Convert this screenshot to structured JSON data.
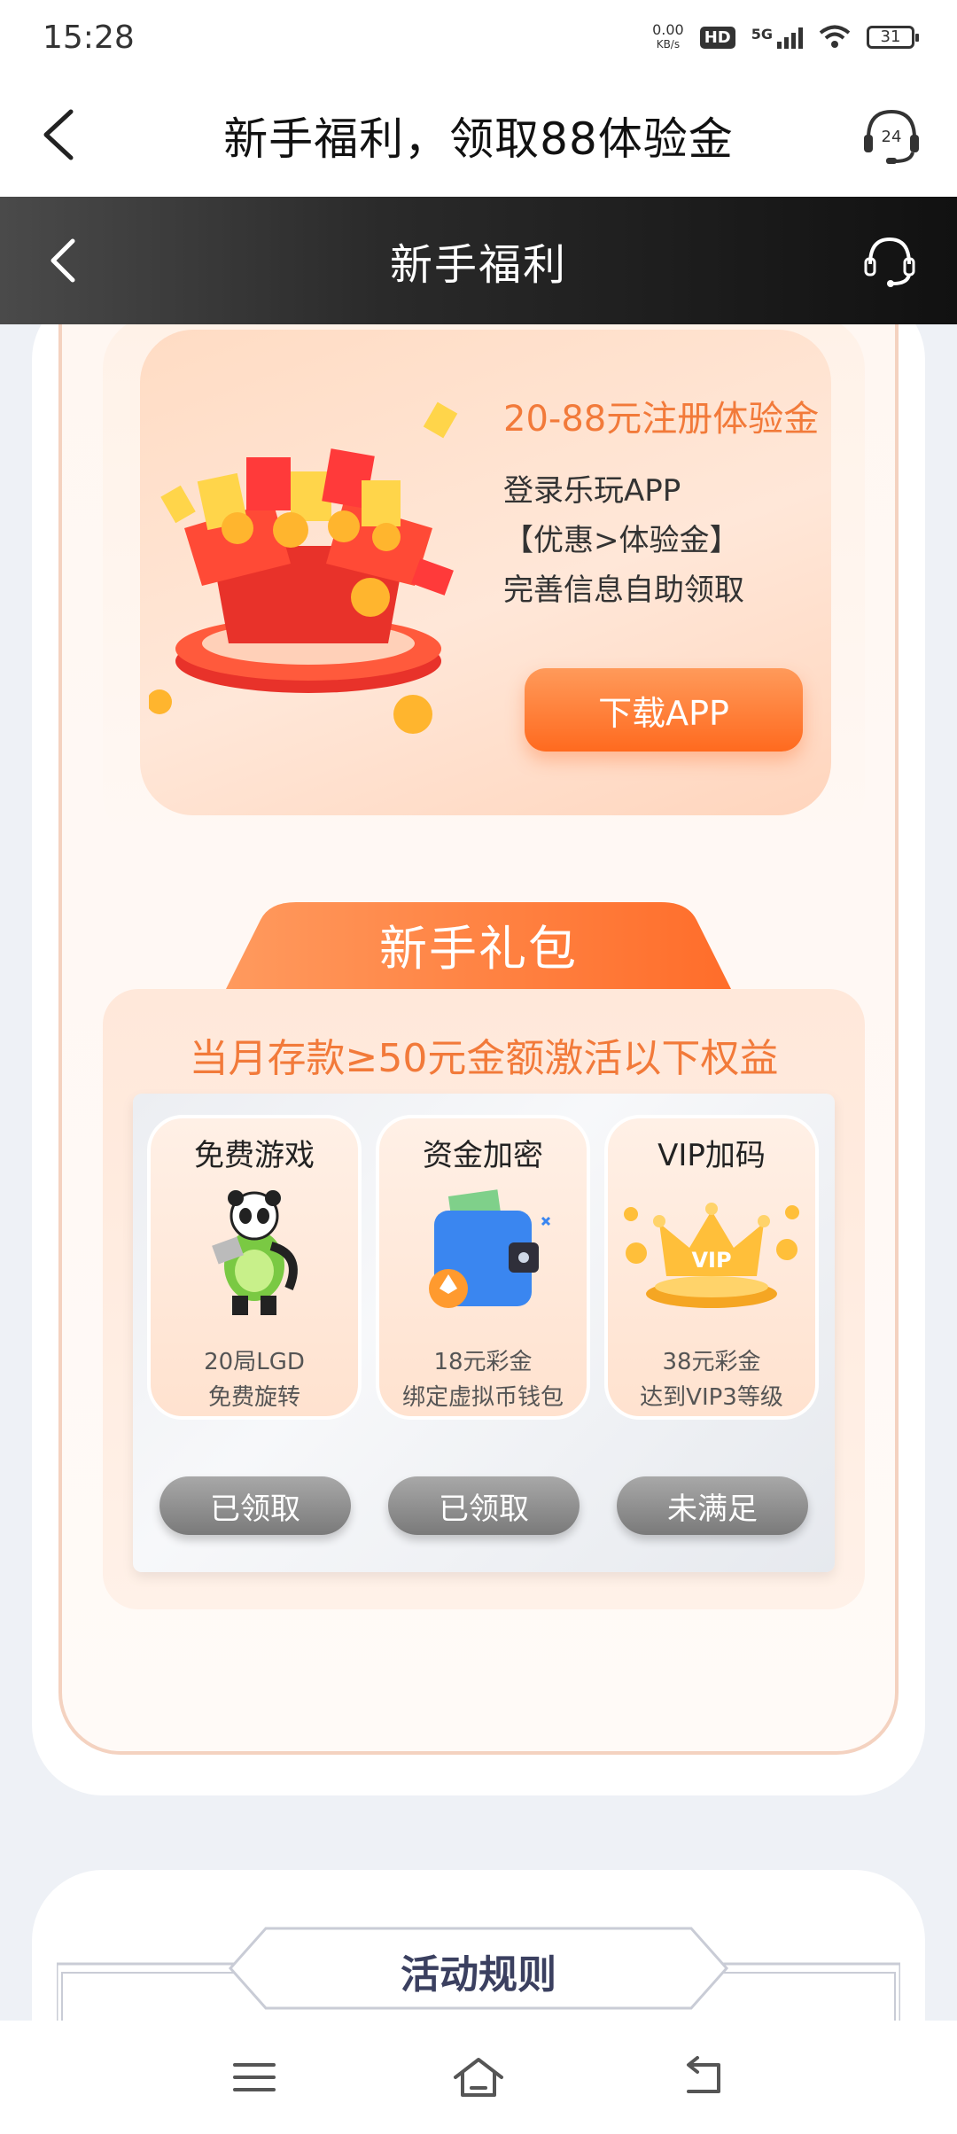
{
  "status": {
    "time": "15:28",
    "net_speed": "0.00",
    "net_unit": "KB/s",
    "hd": "HD",
    "network": "5G",
    "battery": "31"
  },
  "app_header": {
    "title": "新手福利，领取88体验金",
    "support_badge": "24"
  },
  "sub_header": {
    "title": "新手福利"
  },
  "bonus": {
    "title": "20-88元注册体验金",
    "line1": "登录乐玩APP",
    "line2": "【优惠>体验金】",
    "line3": "完善信息自助领取",
    "button": "下载APP"
  },
  "gift_pack": {
    "tab_label": "新手礼包",
    "heading": "当月存款≥50元金额激活以下权益",
    "benefits": [
      {
        "title": "免费游戏",
        "line1": "20局LGD",
        "line2": "免费旋转",
        "button": "已领取"
      },
      {
        "title": "资金加密",
        "line1": "18元彩金",
        "line2": "绑定虚拟币钱包",
        "button": "已领取"
      },
      {
        "title": "VIP加码",
        "line1": "38元彩金",
        "line2": "达到VIP3等级",
        "button": "未满足",
        "vip_text": "VIP"
      }
    ]
  },
  "rules": {
    "title": "活动规则"
  },
  "colors": {
    "accent": "#f27a3a",
    "button_orange": "#ff6a1f",
    "disabled_gray": "#8a8a8a",
    "header_dark": "#1a1a1a"
  }
}
